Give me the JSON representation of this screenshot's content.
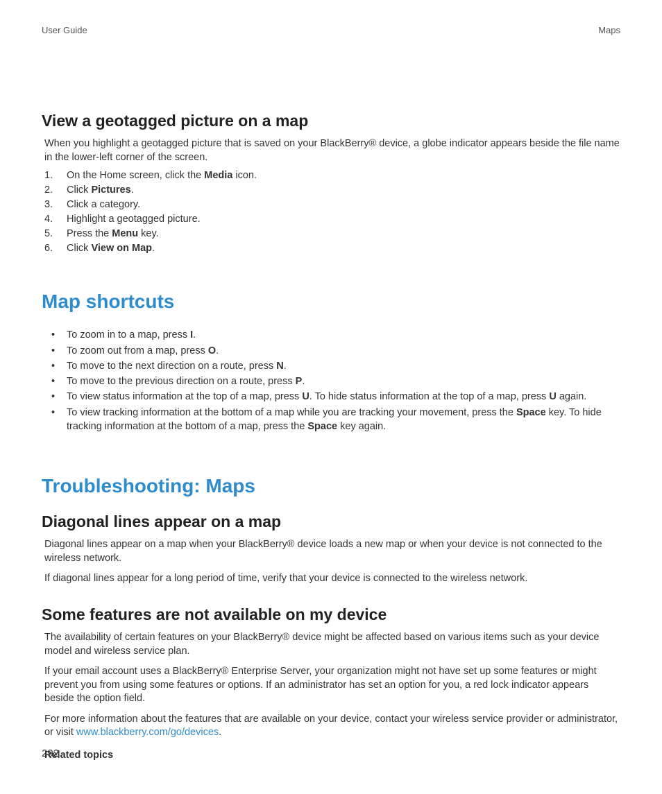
{
  "header": {
    "left": "User Guide",
    "right": "Maps"
  },
  "section1": {
    "heading": "View a geotagged picture on a map",
    "intro": "When you highlight a geotagged picture that is saved on your BlackBerry® device, a globe indicator appears beside the file name in the lower-left corner of the screen.",
    "steps": {
      "s1a": "On the Home screen, click the ",
      "s1b": "Media",
      "s1c": " icon.",
      "s2a": "Click ",
      "s2b": "Pictures",
      "s2c": ".",
      "s3": "Click a category.",
      "s4": "Highlight a geotagged picture.",
      "s5a": "Press the ",
      "s5b": "Menu",
      "s5c": " key.",
      "s6a": "Click ",
      "s6b": "View on Map",
      "s6c": "."
    }
  },
  "section2": {
    "heading": "Map shortcuts",
    "items": {
      "i1a": "To zoom in to a map, press ",
      "i1b": "I",
      "i1c": ".",
      "i2a": "To zoom out from a map, press ",
      "i2b": "O",
      "i2c": ".",
      "i3a": "To move to the next direction on a route, press ",
      "i3b": "N",
      "i3c": ".",
      "i4a": "To move to the previous direction on a route, press ",
      "i4b": "P",
      "i4c": ".",
      "i5a": "To view status information at the top of a map, press ",
      "i5b": "U",
      "i5c": ". To hide status information at the top of a map, press ",
      "i5d": "U",
      "i5e": " again.",
      "i6a": "To view tracking information at the bottom of a map while you are tracking your movement, press the ",
      "i6b": "Space",
      "i6c": " key. To hide tracking information at the bottom of a map, press the ",
      "i6d": "Space",
      "i6e": " key again."
    }
  },
  "section3": {
    "heading": "Troubleshooting: Maps",
    "sub1": {
      "heading": "Diagonal lines appear on a map",
      "p1": "Diagonal lines appear on a map when your BlackBerry® device loads a new map or when your device is not connected to the wireless network.",
      "p2": "If diagonal lines appear for a long period of time, verify that your device is connected to the wireless network."
    },
    "sub2": {
      "heading": "Some features are not available on my device",
      "p1": "The availability of certain features on your BlackBerry® device might be affected based on various items such as your device model and wireless service plan.",
      "p2": "If your email account uses a BlackBerry® Enterprise Server, your organization might not have set up some features or might prevent you from using some features or options. If an administrator has set an option for you, a red lock indicator appears beside the option field.",
      "p3a": "For more information about the features that are available on your device, contact your wireless service provider or administrator, or visit ",
      "p3link": "www.blackberry.com/go/devices",
      "p3b": "."
    },
    "related": "Related topics"
  },
  "pageNumber": "292"
}
